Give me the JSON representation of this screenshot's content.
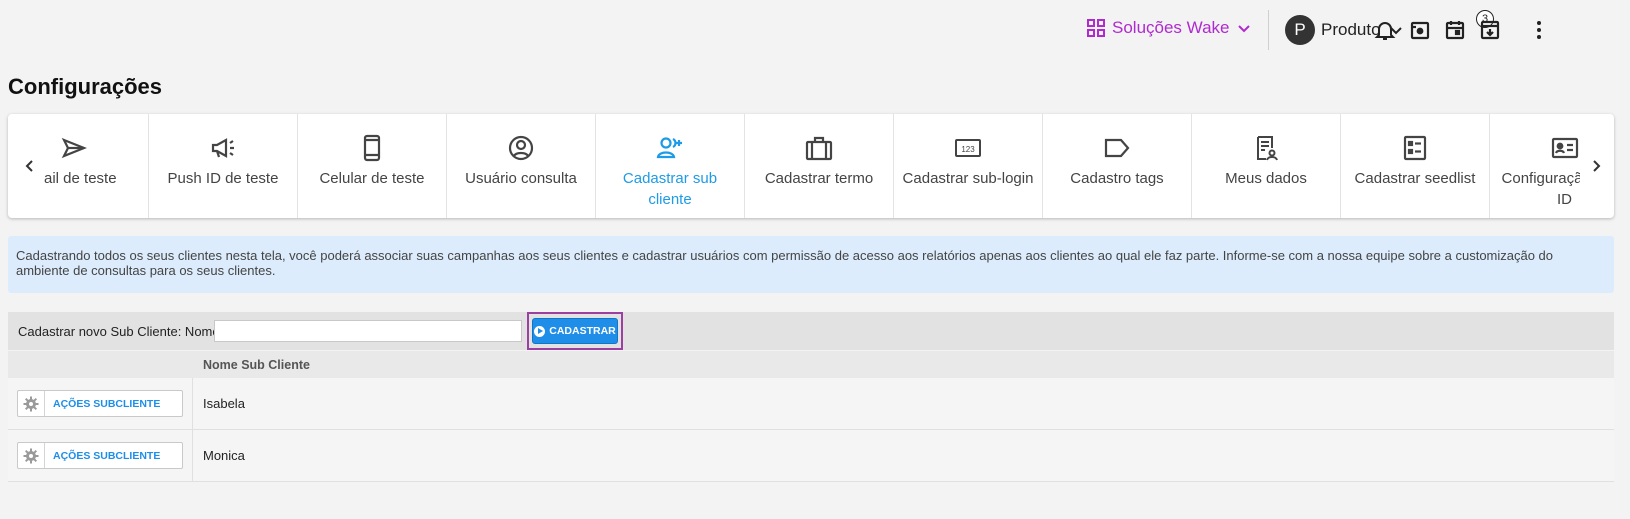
{
  "topbar": {
    "solutions_label": "Soluções Wake",
    "user_initial": "P",
    "user_name": "Produto",
    "notification_badge": "3",
    "icons": [
      "grid-icon",
      "chevron-down-icon",
      "bell-icon",
      "inbox-icon",
      "calendar-icon",
      "download-icon",
      "more-vertical-icon"
    ],
    "accent_color": "#b02ad0"
  },
  "page": {
    "title": "Configurações"
  },
  "tabs": {
    "active_color": "#1e9be6",
    "items": [
      {
        "label": "ail de teste",
        "icon": "send-icon",
        "active": false
      },
      {
        "label": "Push ID de teste",
        "icon": "megaphone-icon",
        "active": false
      },
      {
        "label": "Celular de teste",
        "icon": "phone-icon",
        "active": false
      },
      {
        "label": "Usuário consulta",
        "icon": "user-circle-icon",
        "active": false
      },
      {
        "label": "Cadastrar sub cliente",
        "icon": "user-add-icon",
        "active": true
      },
      {
        "label": "Cadastrar termo",
        "icon": "briefcase-icon",
        "active": false
      },
      {
        "label": "Cadastrar sub-login",
        "icon": "number-pad-icon",
        "active": false
      },
      {
        "label": "Cadastro tags",
        "icon": "tag-icon",
        "active": false
      },
      {
        "label": "Meus dados",
        "icon": "profile-doc-icon",
        "active": false
      },
      {
        "label": "Cadastrar seedlist",
        "icon": "checklist-icon",
        "active": false
      },
      {
        "label": "Configuração push ID",
        "icon": "id-card-icon",
        "active": false
      }
    ]
  },
  "info": {
    "text": "Cadastrando todos os seus clientes nesta tela, você poderá associar suas campanhas aos seus clientes e cadastrar usuários com permissão de acesso aos relatórios apenas aos clientes ao qual ele faz parte. Informe-se com a nossa equipe sobre a customização do ambiente de consultas para os seus clientes."
  },
  "form": {
    "label": "Cadastrar novo Sub Cliente: Nome:",
    "input_value": "",
    "submit_label": "CADASTRAR"
  },
  "table": {
    "header_name": "Nome Sub Cliente",
    "action_label": "AÇÕES SUBCLIENTE",
    "rows": [
      {
        "name": "Isabela"
      },
      {
        "name": "Monica"
      }
    ]
  }
}
